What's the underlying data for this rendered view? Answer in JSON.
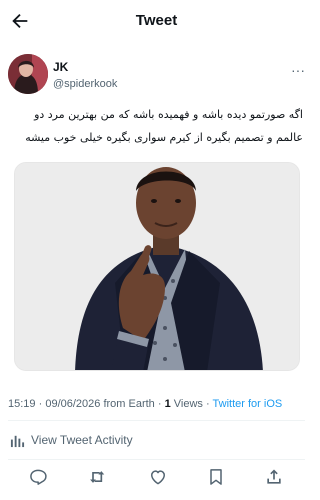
{
  "header": {
    "title": "Tweet"
  },
  "author": {
    "name": "JK",
    "handle": "@spiderkook",
    "more_label": "···"
  },
  "tweet": {
    "text": "اگه صورتمو دیده باشه و فهمیده باشه که من بهترین مرد دو عالمم و تصمیم بگیره از کیرم سواری بگیره خیلی خوب میشه"
  },
  "meta": {
    "time": "15:19",
    "separator": "·",
    "date": "09/06/2026 from Earth",
    "views_count": "1",
    "views_label": "Views",
    "source": "Twitter for iOS"
  },
  "activity": {
    "label": "View Tweet Activity"
  },
  "icons": {
    "back": "arrow-left-icon",
    "more": "more-icon",
    "activity": "bar-chart-icon",
    "reply": "reply-icon",
    "retweet": "retweet-icon",
    "like": "heart-icon",
    "bookmark": "bookmark-icon",
    "share": "share-icon"
  },
  "colors": {
    "link": "#1d9bf0",
    "secondary_text": "#536471",
    "primary_text": "#0f1419"
  }
}
